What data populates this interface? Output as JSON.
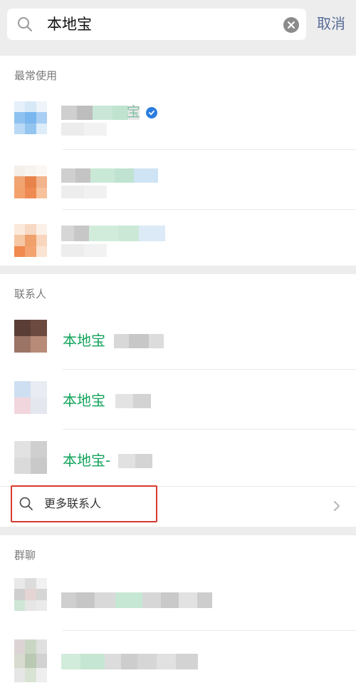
{
  "search": {
    "query": "本地宝",
    "cancel_label": "取消"
  },
  "sections": {
    "frequent_title": "最常使用",
    "contacts_title": "联系人",
    "groups_title": "群聊"
  },
  "contacts": [
    {
      "name": "本地宝"
    },
    {
      "name": "本地宝"
    },
    {
      "name": "本地宝-"
    }
  ],
  "more_contacts": {
    "label": "更多联系人"
  },
  "frequent_first_row": {
    "visible_char": "宝"
  },
  "icons": {
    "search": "search-icon",
    "clear": "clear-icon",
    "verified": "verified-badge-icon",
    "chevron": "chevron-right-icon"
  },
  "colors": {
    "accent_green": "#12a35a",
    "link_blue": "#576b95",
    "highlight_red": "#d93a2f",
    "verified_blue": "#2b7de0"
  }
}
